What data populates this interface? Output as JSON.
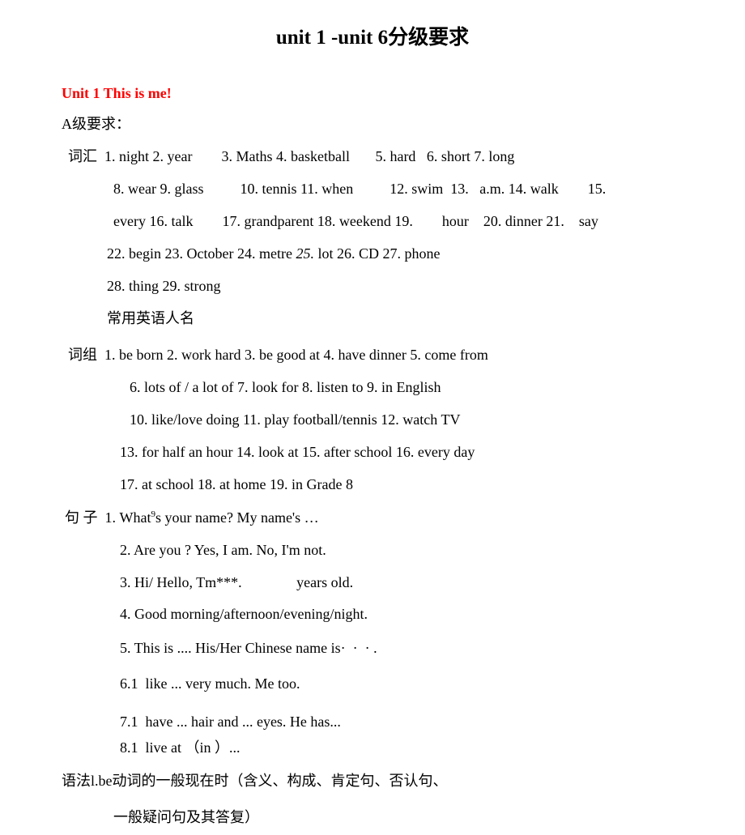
{
  "document": {
    "title": "unit 1 -unit 6分级要求",
    "section_heading": "Unit 1 This is me!",
    "section_heading_color": "#ff0000",
    "sub_heading": "A级要求："
  },
  "labels": {
    "vocabulary": "词汇",
    "phrases": "词组",
    "sentences": "句 子",
    "grammar": "语法"
  },
  "vocabulary": {
    "label": "词汇",
    "lines": [
      "词汇  1. night 2. year        3. Maths 4. basketball       5. hard   6. short 7. long",
      "8. wear 9. glass          10. tennis 11. when          12. swim  13.   a.m. 14. walk        15.",
      "every 16. talk        17. grandparent 18. weekend 19.        hour    20. dinner 21.    say",
      "22. begin 23. October 24. metre ",
      "25.",
      " lot 26. CD 27. phone",
      "28. thing 29. strong",
      "常用英语人名"
    ]
  },
  "phrases": {
    "label": "词组",
    "lines": [
      "词组  1. be born 2. work hard 3. be good at 4. have dinner 5. come from",
      "6. lots of / a lot of 7. look for 8. listen to 9. in English",
      "10. like/love doing 11. play football/tennis 12. watch TV",
      "13. for half an hour 14. look at 15. after school 16. every day",
      "17. at school 18. at home 19. in Grade 8"
    ]
  },
  "sentences": {
    "label": "句 子",
    "line1_prefix": "句 子  1. What",
    "line1_apostrophe": "9",
    "line1_suffix": "s your name? My name's …",
    "lines": [
      "2. Are you ? Yes, I am. No, I'm not.",
      "3. Hi/ Hello, Tm***.               years old.",
      "4. Good morning/afternoon/evening/night.",
      "5. This is .... His/Her Chinese name is·  ·  · .",
      "6.1  like ... very much. Me too.",
      "7.1  have ... hair and ... eyes. He has...",
      "8.1  live at （in ）..."
    ]
  },
  "grammar": {
    "label": "语法",
    "lines": [
      "语法l.be动词的一般现在时（含义、构成、肯定句、否认句、",
      "一般疑问句及其答复）"
    ]
  }
}
